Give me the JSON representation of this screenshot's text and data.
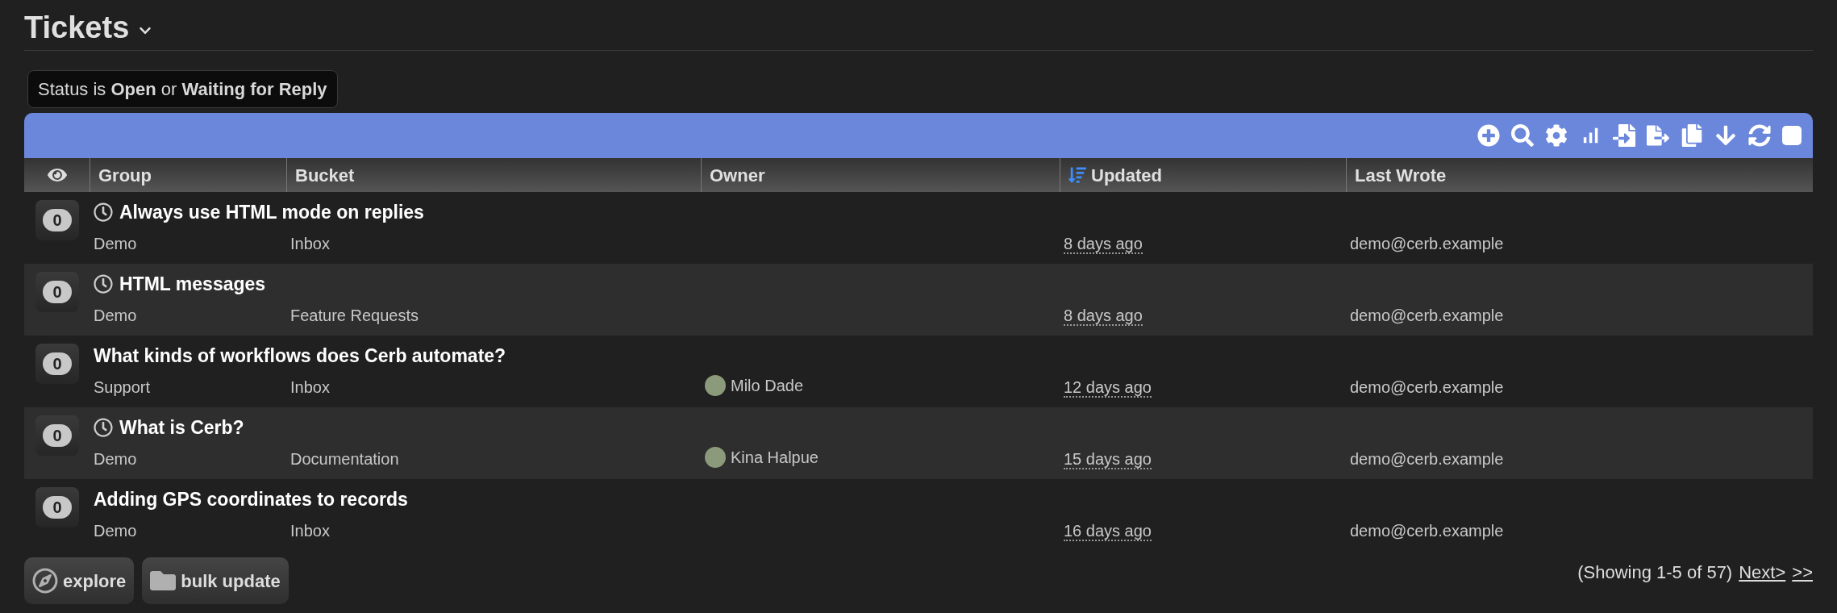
{
  "title": "Tickets",
  "filter": "Status is **Open** or **Waiting for Reply**",
  "toolbar": {
    "select_all_checked": false
  },
  "columns": [
    {
      "label": "Group",
      "sorted": false
    },
    {
      "label": "Bucket",
      "sorted": false
    },
    {
      "label": "Owner",
      "sorted": false
    },
    {
      "label": "Updated",
      "sorted": true
    },
    {
      "label": "Last Wrote",
      "sorted": false
    }
  ],
  "rows": [
    {
      "count": "0",
      "waiting": true,
      "subject": "Always use HTML mode on replies",
      "group": "Demo",
      "bucket": "Inbox",
      "owner": "",
      "updated": "8 days ago",
      "last_wrote": "demo@cerb.example"
    },
    {
      "count": "0",
      "waiting": true,
      "subject": "HTML messages",
      "group": "Demo",
      "bucket": "Feature Requests",
      "owner": "",
      "updated": "8 days ago",
      "last_wrote": "demo@cerb.example"
    },
    {
      "count": "0",
      "waiting": false,
      "subject": "What kinds of workflows does Cerb automate?",
      "group": "Support",
      "bucket": "Inbox",
      "owner": "Milo Dade",
      "updated": "12 days ago",
      "last_wrote": "demo@cerb.example"
    },
    {
      "count": "0",
      "waiting": true,
      "subject": "What is Cerb?",
      "group": "Demo",
      "bucket": "Documentation",
      "owner": "Kina Halpue",
      "updated": "15 days ago",
      "last_wrote": "demo@cerb.example"
    },
    {
      "count": "0",
      "waiting": false,
      "subject": "Adding GPS coordinates to records",
      "group": "Demo",
      "bucket": "Inbox",
      "owner": "",
      "updated": "16 days ago",
      "last_wrote": "demo@cerb.example"
    }
  ],
  "buttons": [
    "explore",
    "bulk update"
  ],
  "paging": {
    "summary": "(Showing 1-5 of 57)",
    "next": "Next>",
    "last": ">>"
  }
}
